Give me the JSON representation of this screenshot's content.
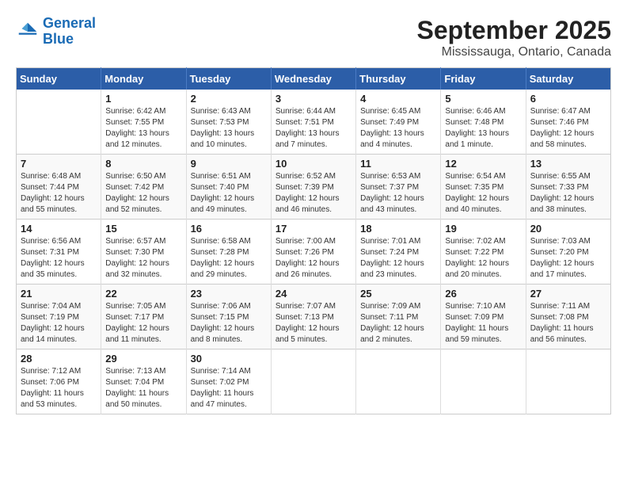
{
  "logo": {
    "line1": "General",
    "line2": "Blue"
  },
  "title": "September 2025",
  "subtitle": "Mississauga, Ontario, Canada",
  "weekdays": [
    "Sunday",
    "Monday",
    "Tuesday",
    "Wednesday",
    "Thursday",
    "Friday",
    "Saturday"
  ],
  "weeks": [
    [
      {
        "day": "",
        "info": ""
      },
      {
        "day": "1",
        "info": "Sunrise: 6:42 AM\nSunset: 7:55 PM\nDaylight: 13 hours\nand 12 minutes."
      },
      {
        "day": "2",
        "info": "Sunrise: 6:43 AM\nSunset: 7:53 PM\nDaylight: 13 hours\nand 10 minutes."
      },
      {
        "day": "3",
        "info": "Sunrise: 6:44 AM\nSunset: 7:51 PM\nDaylight: 13 hours\nand 7 minutes."
      },
      {
        "day": "4",
        "info": "Sunrise: 6:45 AM\nSunset: 7:49 PM\nDaylight: 13 hours\nand 4 minutes."
      },
      {
        "day": "5",
        "info": "Sunrise: 6:46 AM\nSunset: 7:48 PM\nDaylight: 13 hours\nand 1 minute."
      },
      {
        "day": "6",
        "info": "Sunrise: 6:47 AM\nSunset: 7:46 PM\nDaylight: 12 hours\nand 58 minutes."
      }
    ],
    [
      {
        "day": "7",
        "info": "Sunrise: 6:48 AM\nSunset: 7:44 PM\nDaylight: 12 hours\nand 55 minutes."
      },
      {
        "day": "8",
        "info": "Sunrise: 6:50 AM\nSunset: 7:42 PM\nDaylight: 12 hours\nand 52 minutes."
      },
      {
        "day": "9",
        "info": "Sunrise: 6:51 AM\nSunset: 7:40 PM\nDaylight: 12 hours\nand 49 minutes."
      },
      {
        "day": "10",
        "info": "Sunrise: 6:52 AM\nSunset: 7:39 PM\nDaylight: 12 hours\nand 46 minutes."
      },
      {
        "day": "11",
        "info": "Sunrise: 6:53 AM\nSunset: 7:37 PM\nDaylight: 12 hours\nand 43 minutes."
      },
      {
        "day": "12",
        "info": "Sunrise: 6:54 AM\nSunset: 7:35 PM\nDaylight: 12 hours\nand 40 minutes."
      },
      {
        "day": "13",
        "info": "Sunrise: 6:55 AM\nSunset: 7:33 PM\nDaylight: 12 hours\nand 38 minutes."
      }
    ],
    [
      {
        "day": "14",
        "info": "Sunrise: 6:56 AM\nSunset: 7:31 PM\nDaylight: 12 hours\nand 35 minutes."
      },
      {
        "day": "15",
        "info": "Sunrise: 6:57 AM\nSunset: 7:30 PM\nDaylight: 12 hours\nand 32 minutes."
      },
      {
        "day": "16",
        "info": "Sunrise: 6:58 AM\nSunset: 7:28 PM\nDaylight: 12 hours\nand 29 minutes."
      },
      {
        "day": "17",
        "info": "Sunrise: 7:00 AM\nSunset: 7:26 PM\nDaylight: 12 hours\nand 26 minutes."
      },
      {
        "day": "18",
        "info": "Sunrise: 7:01 AM\nSunset: 7:24 PM\nDaylight: 12 hours\nand 23 minutes."
      },
      {
        "day": "19",
        "info": "Sunrise: 7:02 AM\nSunset: 7:22 PM\nDaylight: 12 hours\nand 20 minutes."
      },
      {
        "day": "20",
        "info": "Sunrise: 7:03 AM\nSunset: 7:20 PM\nDaylight: 12 hours\nand 17 minutes."
      }
    ],
    [
      {
        "day": "21",
        "info": "Sunrise: 7:04 AM\nSunset: 7:19 PM\nDaylight: 12 hours\nand 14 minutes."
      },
      {
        "day": "22",
        "info": "Sunrise: 7:05 AM\nSunset: 7:17 PM\nDaylight: 12 hours\nand 11 minutes."
      },
      {
        "day": "23",
        "info": "Sunrise: 7:06 AM\nSunset: 7:15 PM\nDaylight: 12 hours\nand 8 minutes."
      },
      {
        "day": "24",
        "info": "Sunrise: 7:07 AM\nSunset: 7:13 PM\nDaylight: 12 hours\nand 5 minutes."
      },
      {
        "day": "25",
        "info": "Sunrise: 7:09 AM\nSunset: 7:11 PM\nDaylight: 12 hours\nand 2 minutes."
      },
      {
        "day": "26",
        "info": "Sunrise: 7:10 AM\nSunset: 7:09 PM\nDaylight: 11 hours\nand 59 minutes."
      },
      {
        "day": "27",
        "info": "Sunrise: 7:11 AM\nSunset: 7:08 PM\nDaylight: 11 hours\nand 56 minutes."
      }
    ],
    [
      {
        "day": "28",
        "info": "Sunrise: 7:12 AM\nSunset: 7:06 PM\nDaylight: 11 hours\nand 53 minutes."
      },
      {
        "day": "29",
        "info": "Sunrise: 7:13 AM\nSunset: 7:04 PM\nDaylight: 11 hours\nand 50 minutes."
      },
      {
        "day": "30",
        "info": "Sunrise: 7:14 AM\nSunset: 7:02 PM\nDaylight: 11 hours\nand 47 minutes."
      },
      {
        "day": "",
        "info": ""
      },
      {
        "day": "",
        "info": ""
      },
      {
        "day": "",
        "info": ""
      },
      {
        "day": "",
        "info": ""
      }
    ]
  ]
}
